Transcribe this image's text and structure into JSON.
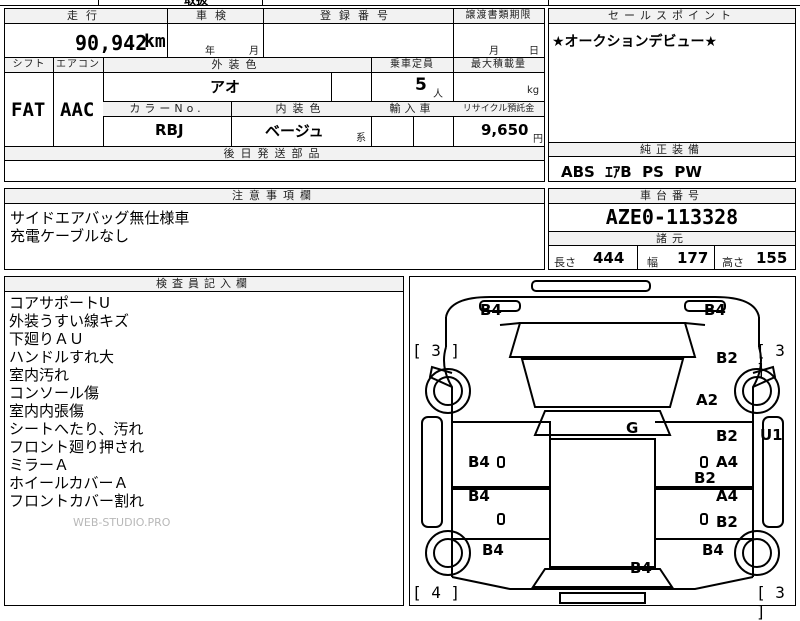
{
  "top_strip": {
    "partial_text": "取扱"
  },
  "mileage": {
    "header": "走行",
    "value": "90,942",
    "unit": "km"
  },
  "inspection": {
    "header": "車検",
    "year_label": "年",
    "month_label": "月"
  },
  "registration": {
    "header": "登録番号"
  },
  "transfer_deadline": {
    "header": "譲渡書類期限",
    "month_label": "月",
    "day_label": "日"
  },
  "sales_point": {
    "header": "セールスポイント",
    "text": "★オークションデビュー★"
  },
  "shift": {
    "header": "シフト",
    "value": "FAT"
  },
  "aircon": {
    "header": "エアコン",
    "value": "AAC"
  },
  "exterior_color": {
    "header": "外装色",
    "value": "アオ"
  },
  "capacity": {
    "header": "乗車定員",
    "value": "5",
    "unit": "人"
  },
  "max_load": {
    "header": "最大積載量",
    "unit": "kg"
  },
  "color_no": {
    "header": "カラーNo.",
    "value": "RBJ"
  },
  "interior_color": {
    "header": "内装色",
    "value": "ベージュ",
    "suffix": "系"
  },
  "import": {
    "header": "輸入車"
  },
  "recycle": {
    "header": "リサイクル預託金",
    "value": "9,650",
    "unit": "円"
  },
  "later_parts": {
    "header": "後日発送部品"
  },
  "standard_equipment": {
    "header": "純正装備",
    "value": "ABS  ｴｱB  PS  PW"
  },
  "notes": {
    "header": "注意事項欄",
    "lines": [
      "サイドエアバッグ無仕様車",
      "充電ケーブルなし"
    ]
  },
  "chassis": {
    "header": "車台番号",
    "value": "AZE0-113328"
  },
  "specs": {
    "header": "諸元",
    "length_label": "長さ",
    "length_value": "444",
    "width_label": "幅",
    "width_value": "177",
    "height_label": "高さ",
    "height_value": "155"
  },
  "inspector": {
    "header": "検査員記入欄",
    "lines": [
      "コアサポートU",
      "外装うすい線キズ",
      "下廻りＡＵ",
      "ハンドルすれ大",
      "室内汚れ",
      "コンソール傷",
      "室内内張傷",
      "シートへたり、汚れ",
      "フロント廻り押され",
      "ミラーＡ",
      "ホイールカバーＡ",
      "フロントカバー割れ"
    ],
    "watermark": "WEB-STUDIO.PRO"
  },
  "diagram": {
    "codes": {
      "b4_top_left": "B4",
      "b4_top_right": "B4",
      "b2_right_front": "B2",
      "a2_right": "A2",
      "g_center": "G",
      "b2_right_door": "B2",
      "u1_right": "U1",
      "b4_left_front_door": "B4",
      "a4_right_front_door": "A4",
      "b2_right_mid": "B2",
      "b4_left_rear_door": "B4",
      "a4_right_rear_door": "A4",
      "b2_right_rear_door": "B2",
      "b4_left_rear": "B4",
      "b4_rear_center": "B4",
      "b4_right_rear": "B4"
    },
    "tire_labels": {
      "front_left": "[ 3 ]",
      "front_right": "[ 3 ]",
      "rear_left": "[ 4 ]",
      "rear_right": "[ 3 ]"
    }
  }
}
